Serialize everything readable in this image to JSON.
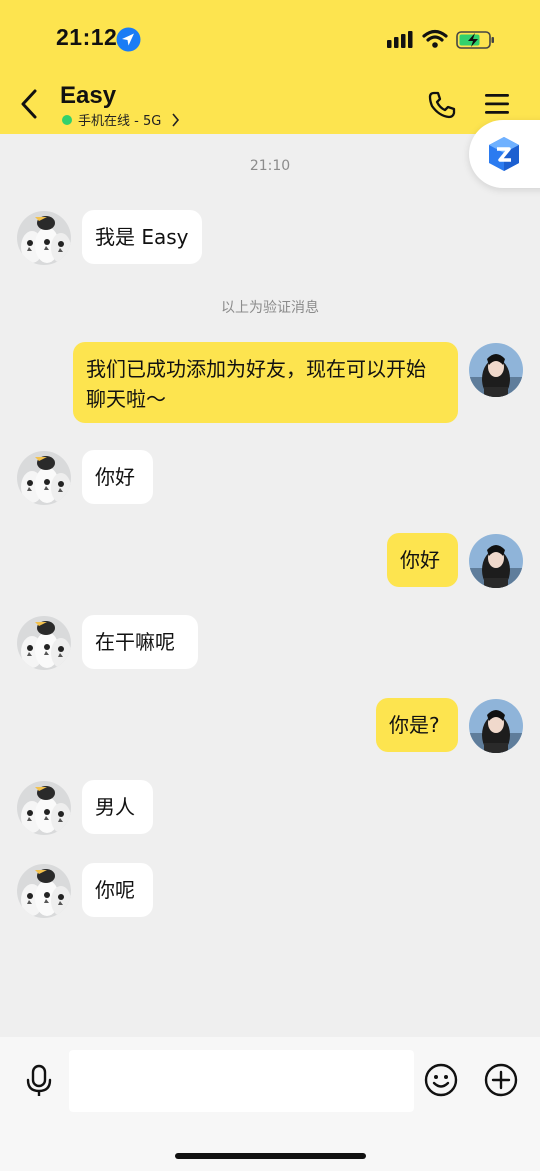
{
  "status_bar": {
    "time": "21:12"
  },
  "header": {
    "contact_name": "Easy",
    "online_status": "手机在线 - 5G"
  },
  "chat": {
    "timestamp": "21:10",
    "system_note": "以上为验证消息",
    "messages": [
      {
        "side": "in",
        "avatar": "penguin-avatar",
        "text": "我是 Easy"
      },
      {
        "side": "out",
        "avatar": "user-avatar",
        "text": "我们已成功添加为好友，现在可以开始聊天啦～"
      },
      {
        "side": "in",
        "avatar": "penguin-avatar",
        "text": "你好"
      },
      {
        "side": "out",
        "avatar": "user-avatar",
        "text": "你好"
      },
      {
        "side": "in",
        "avatar": "penguin-avatar",
        "text": "在干嘛呢"
      },
      {
        "side": "out",
        "avatar": "user-avatar",
        "text": "你是?"
      },
      {
        "side": "in",
        "avatar": "penguin-avatar",
        "text": "男人"
      },
      {
        "side": "in",
        "avatar": "penguin-avatar",
        "text": "你呢"
      }
    ]
  },
  "input": {
    "placeholder": ""
  },
  "colors": {
    "accent": "#fde44f",
    "background": "#efefef",
    "online_dot": "#31d16c"
  }
}
